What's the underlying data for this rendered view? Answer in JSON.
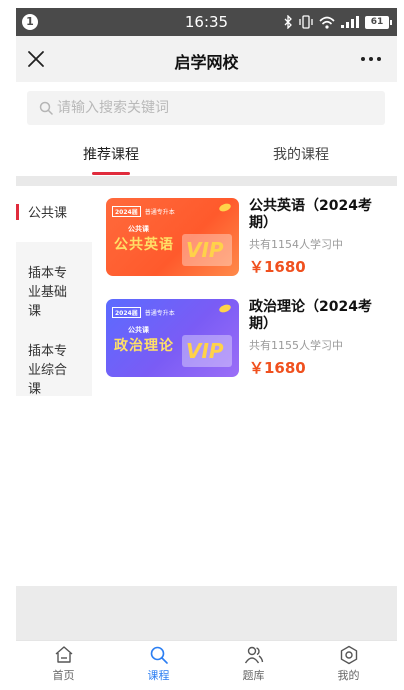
{
  "status_bar": {
    "notification_count": "1",
    "time": "16:35",
    "battery": "61"
  },
  "nav": {
    "title": "启学网校",
    "close_icon": "close-icon",
    "more_icon": "more-icon"
  },
  "search": {
    "placeholder": "请输入搜索关键词",
    "value": ""
  },
  "tabs": [
    {
      "label": "推荐课程",
      "active": true
    },
    {
      "label": "我的课程",
      "active": false
    }
  ],
  "sidebar": {
    "items": [
      {
        "label": "公共课",
        "active": true
      },
      {
        "label": "插本专业基础课",
        "active": false
      },
      {
        "label": "插本专业综合课",
        "active": false
      }
    ]
  },
  "courses": [
    {
      "title": "公共英语（2024考期）",
      "learners": "共有1154人学习中",
      "price": "￥1680",
      "thumb": {
        "year": "2024届",
        "brand": "普通专升本",
        "category": "公共课",
        "subject": "公共英语",
        "badge": "VIP"
      }
    },
    {
      "title": "政治理论（2024考期）",
      "learners": "共有1155人学习中",
      "price": "￥1680",
      "thumb": {
        "year": "2024届",
        "brand": "普通专升本",
        "category": "公共课",
        "subject": "政治理论",
        "badge": "VIP"
      }
    }
  ],
  "tab_bar": {
    "items": [
      {
        "label": "首页",
        "icon": "home-icon",
        "active": false
      },
      {
        "label": "课程",
        "icon": "search-icon",
        "active": true
      },
      {
        "label": "题库",
        "icon": "users-icon",
        "active": false
      },
      {
        "label": "我的",
        "icon": "gear-icon",
        "active": false
      }
    ]
  },
  "colors": {
    "accent_red": "#e02b3c",
    "price_orange": "#f0501e",
    "tab_active_blue": "#2b7ef2"
  }
}
